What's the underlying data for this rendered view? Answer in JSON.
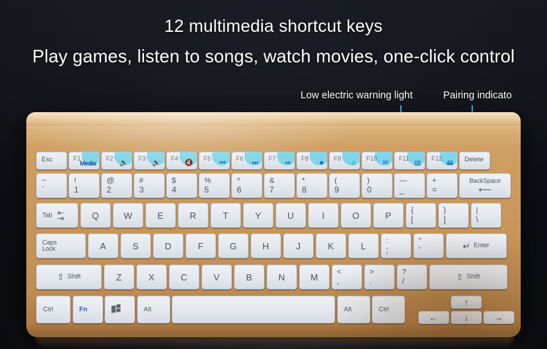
{
  "headline": {
    "line1": "12 multimedia shortcut keys",
    "line2": "Play games, listen to songs, watch movies, one-click control"
  },
  "callouts": {
    "low_battery": "Low electric warning light",
    "pairing": "Pairing indicato",
    "accent_color": "#2fc6e8"
  },
  "indicator": {
    "name": "status-indicator-window"
  },
  "keyboard": {
    "body_color": "#c8965a",
    "keycap_color": "#e6eaf0",
    "function_row": [
      {
        "key": "Esc",
        "icon": "",
        "icon_char": "",
        "highlight": false
      },
      {
        "key": "F1",
        "icon": "media",
        "icon_char": "Media",
        "highlight": true
      },
      {
        "key": "F2",
        "icon": "volume-down",
        "icon_char": "🔉",
        "highlight": true
      },
      {
        "key": "F3",
        "icon": "volume-up",
        "icon_char": "🔊",
        "highlight": true
      },
      {
        "key": "F4",
        "icon": "volume-mute",
        "icon_char": "🔇",
        "highlight": true
      },
      {
        "key": "F5",
        "icon": "previous-track",
        "icon_char": "⏮",
        "highlight": true
      },
      {
        "key": "F6",
        "icon": "next-track",
        "icon_char": "⏭",
        "highlight": true
      },
      {
        "key": "F7",
        "icon": "play-pause",
        "icon_char": "⏯",
        "highlight": true
      },
      {
        "key": "F8",
        "icon": "stop",
        "icon_char": "⏹",
        "highlight": true
      },
      {
        "key": "F9",
        "icon": "home-browser",
        "icon_char": "⌂",
        "highlight": true
      },
      {
        "key": "F10",
        "icon": "mail",
        "icon_char": "✉",
        "highlight": true
      },
      {
        "key": "F11",
        "icon": "calculator",
        "icon_char": "▤",
        "highlight": true
      },
      {
        "key": "F12",
        "icon": "my-computer",
        "icon_char": "🖴",
        "highlight": true
      },
      {
        "key": "Delete",
        "icon": "",
        "icon_char": "",
        "highlight": false
      }
    ],
    "number_row": [
      {
        "top": "~",
        "bottom": "`"
      },
      {
        "top": "!",
        "bottom": "1"
      },
      {
        "top": "@",
        "bottom": "2"
      },
      {
        "top": "#",
        "bottom": "3"
      },
      {
        "top": "$",
        "bottom": "4"
      },
      {
        "top": "%",
        "bottom": "5"
      },
      {
        "top": "^",
        "bottom": "6"
      },
      {
        "top": "&",
        "bottom": "7"
      },
      {
        "top": "*",
        "bottom": "8"
      },
      {
        "top": "(",
        "bottom": "9"
      },
      {
        "top": ")",
        "bottom": "0"
      },
      {
        "top": "—",
        "bottom": "_"
      },
      {
        "top": "+",
        "bottom": "="
      }
    ],
    "backspace_label": "BackSpace",
    "backspace_arrow": "⟵",
    "tab_label": "Tab",
    "qwerty_row": [
      "Q",
      "W",
      "E",
      "R",
      "T",
      "Y",
      "U",
      "I",
      "O",
      "P"
    ],
    "qwerty_extra": [
      {
        "top": "{",
        "bottom": "["
      },
      {
        "top": "}",
        "bottom": "]"
      },
      {
        "top": "|",
        "bottom": "\\"
      }
    ],
    "caps_label_line1": "Caps",
    "caps_label_line2": "Lock",
    "home_row": [
      "A",
      "S",
      "D",
      "F",
      "G",
      "H",
      "J",
      "K",
      "L"
    ],
    "home_extra": [
      {
        "top": ":",
        "bottom": ";"
      },
      {
        "top": "\"",
        "bottom": "'"
      }
    ],
    "enter_label": "Enter",
    "enter_arrow": "↵",
    "shift_label": "Shift",
    "shift_arrow": "⇧",
    "bottom_letters": [
      "Z",
      "X",
      "C",
      "V",
      "B",
      "N",
      "M"
    ],
    "bottom_extra": [
      {
        "top": "<",
        "bottom": ","
      },
      {
        "top": ">",
        "bottom": "."
      },
      {
        "top": "?",
        "bottom": "/"
      }
    ],
    "modifier_row": {
      "ctrl_left": "Ctrl",
      "fn": "Fn",
      "win": "windows-logo",
      "alt_left": "Alt",
      "space": "",
      "alt_right": "Alt",
      "ctrl_right": "Ctrl"
    },
    "arrows": {
      "up": "↑",
      "down": "↓",
      "left": "←",
      "right": "→"
    }
  }
}
